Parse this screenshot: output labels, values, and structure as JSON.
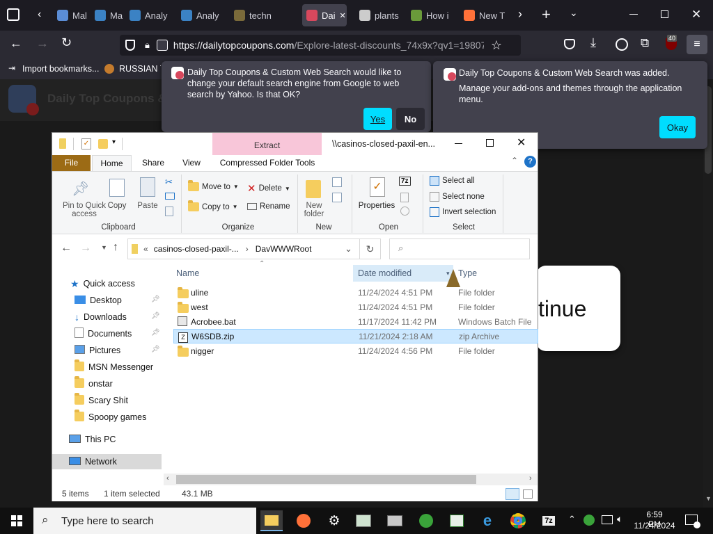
{
  "browser": {
    "tabs": [
      {
        "label": "Malw",
        "color": "#5b8dd6"
      },
      {
        "label": "Malw",
        "color": "#3b82c4"
      },
      {
        "label": "Analy",
        "color": "#3b82c4"
      },
      {
        "label": "Analy",
        "color": "#3b82c4"
      },
      {
        "label": "techn",
        "color": "#7a6a3a"
      },
      {
        "label": "Dai",
        "color": "#d8485d"
      },
      {
        "label": "plants",
        "color": "#cccccc"
      },
      {
        "label": "How i",
        "color": "#6a9a3a"
      },
      {
        "label": "New T",
        "color": "#ff7139"
      }
    ],
    "url": "https://dailytopcoupons.com/Explore-latest-discounts_74x9x?qv1=19807",
    "url_host": "https://dailytopcoupons.com",
    "url_rest": "/Explore-latest-discounts_74x9x?qv1=19807",
    "extensions_badge": "40",
    "bookmarks": [
      {
        "label": "Import bookmarks..."
      },
      {
        "label": "RUSSIAN TI"
      }
    ]
  },
  "page": {
    "header_title": "Daily Top Coupons &",
    "continue_text": "tinue"
  },
  "popups": {
    "search_change": {
      "message": "Daily Top Coupons & Custom Web Search would like to change your default search engine from Google to web search by Yahoo. Is that OK?",
      "yes_label": "Yes",
      "no_label": "No"
    },
    "addon_added": {
      "title": "Daily Top Coupons & Custom Web Search was added.",
      "message": "Manage your add-ons and themes through the application menu.",
      "ok_label": "Okay"
    }
  },
  "explorer": {
    "title": "\\\\casinos-closed-paxil-en...",
    "context_tab": "Extract",
    "ribbon_tabs": [
      "File",
      "Home",
      "Share",
      "View",
      "Compressed Folder Tools"
    ],
    "ribbon": {
      "clipboard": {
        "pin": "Pin to Quick access",
        "copy": "Copy",
        "paste": "Paste",
        "label": "Clipboard"
      },
      "organize": {
        "move_to": "Move to",
        "copy_to": "Copy to",
        "delete": "Delete",
        "rename": "Rename",
        "label": "Organize"
      },
      "new": {
        "new_folder": "New folder",
        "label": "New"
      },
      "open": {
        "properties": "Properties",
        "label": "Open"
      },
      "select": {
        "select_all": "Select all",
        "select_none": "Select none",
        "invert": "Invert selection",
        "label": "Select"
      }
    },
    "address": {
      "crumbs": [
        "casinos-closed-paxil-...",
        "DavWWWRoot"
      ],
      "prefix": "«"
    },
    "nav": [
      {
        "label": "Quick access",
        "kind": "star",
        "pinned": false
      },
      {
        "label": "Desktop",
        "kind": "desktop",
        "pinned": true
      },
      {
        "label": "Downloads",
        "kind": "download",
        "pinned": true
      },
      {
        "label": "Documents",
        "kind": "document",
        "pinned": true
      },
      {
        "label": "Pictures",
        "kind": "picture",
        "pinned": true
      },
      {
        "label": "MSN Messenger",
        "kind": "folder",
        "pinned": false
      },
      {
        "label": "onstar",
        "kind": "folder",
        "pinned": false
      },
      {
        "label": "Scary Shit",
        "kind": "folder",
        "pinned": false
      },
      {
        "label": "Spoopy games",
        "kind": "folder",
        "pinned": false
      },
      {
        "label": "This PC",
        "kind": "pc",
        "pinned": false
      },
      {
        "label": "Network",
        "kind": "network",
        "pinned": false
      }
    ],
    "columns": {
      "name": "Name",
      "date": "Date modified",
      "type": "Type"
    },
    "files": [
      {
        "name": "uline",
        "date": "11/24/2024 4:51 PM",
        "type": "File folder",
        "kind": "folder",
        "selected": false
      },
      {
        "name": "west",
        "date": "11/24/2024 4:51 PM",
        "type": "File folder",
        "kind": "folder",
        "selected": false
      },
      {
        "name": "Acrobee.bat",
        "date": "11/17/2024 11:42 PM",
        "type": "Windows Batch File",
        "kind": "bat",
        "selected": false
      },
      {
        "name": "W6SDB.zip",
        "date": "11/21/2024 2:18 AM",
        "type": "zip Archive",
        "kind": "zip",
        "selected": true
      },
      {
        "name": "nigger",
        "date": "11/24/2024 4:56 PM",
        "type": "File folder",
        "kind": "folder",
        "selected": false
      }
    ],
    "status": {
      "items": "5 items",
      "selected": "1 item selected",
      "size": "43.1 MB"
    }
  },
  "taskbar": {
    "search_placeholder": "Type here to search",
    "time": "6:59 PM",
    "date": "11/24/2024"
  }
}
